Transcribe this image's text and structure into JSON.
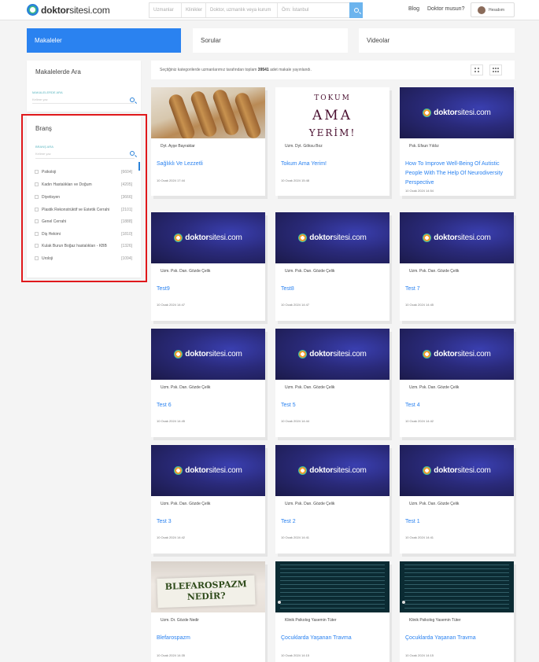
{
  "header": {
    "logo_bold": "doktor",
    "logo_rest": "sitesi.com",
    "search_segments": [
      "Uzmanlar",
      "Klinikler",
      "Doktor, uzmanlık veya kurum",
      "Örn: İstanbul"
    ],
    "blog": "Blog",
    "doctor_q": "Doktor musun?",
    "account": "Hesabım"
  },
  "tabs": [
    "Makaleler",
    "Sorular",
    "Videolar"
  ],
  "sidebar": {
    "search_title": "Makalelerde Ara",
    "search_label": "MAKALELERDE ARA",
    "search_placeholder": "Kelime yaz",
    "branch_title": "Branş",
    "branch_label": "BRANŞ ARA",
    "branch_placeholder": "Kelime yaz",
    "branches": [
      {
        "name": "Psikoloji",
        "count": "[6604]"
      },
      {
        "name": "Kadın Hastalıkları ve Doğum",
        "count": "[4205]"
      },
      {
        "name": "Diyetisyen",
        "count": "[3666]"
      },
      {
        "name": "Plastik Rekonstrüktif ve Estetik Cerrahi",
        "count": "[2101]"
      },
      {
        "name": "Genel Cerrahi",
        "count": "[1888]"
      },
      {
        "name": "Diş Hekimi",
        "count": "[1810]"
      },
      {
        "name": "Kulak Burun Boğaz hastalıkları - KBB",
        "count": "[1326]"
      },
      {
        "name": "Üroloji",
        "count": "[1094]"
      }
    ]
  },
  "info": {
    "prefix": "Seçtiğiniz kategorilerde uzmanlarımız tarafından toplam ",
    "count": "39541",
    "suffix": " adet makale yayınlandı."
  },
  "brand_thumb": {
    "bold": "doktor",
    "rest": "sitesi.com"
  },
  "cards": [
    {
      "thumb": "food",
      "author": "Dyt. Ayşe Bayraktar",
      "title": "Sağlıklı Ve Lezzetli",
      "date": "10 Ocak 2024 17:44"
    },
    {
      "thumb": "tokum",
      "thumb_text": [
        "TOKUM",
        "AMA",
        "YERİM!"
      ],
      "author": "Uzm. Dyt. Göksu Boz",
      "title": "Tokum Ama Yerim!",
      "date": "10 Ocak 2024 15:48"
    },
    {
      "thumb": "brand",
      "author": "Psk. Efsun Yıldız",
      "title": "How To Improve Well-Being Of Autistic People With The Help Of Neurodiversity Perspective",
      "date": "10 Ocak 2024 14:54"
    },
    {
      "thumb": "brand",
      "author": "Uzm. Psk. Dan. Gözde Çelik",
      "title": "Test9",
      "date": "10 Ocak 2024 14:47"
    },
    {
      "thumb": "brand",
      "author": "Uzm. Psk. Dan. Gözde Çelik",
      "title": "Test8",
      "date": "10 Ocak 2024 14:47"
    },
    {
      "thumb": "brand",
      "author": "Uzm. Psk. Dan. Gözde Çelik",
      "title": "Test 7",
      "date": "10 Ocak 2024 14:45"
    },
    {
      "thumb": "brand",
      "author": "Uzm. Psk. Dan. Gözde Çelik",
      "title": "Test 6",
      "date": "10 Ocak 2024 14:45"
    },
    {
      "thumb": "brand",
      "author": "Uzm. Psk. Dan. Gözde Çelik",
      "title": "Test 5",
      "date": "10 Ocak 2024 14:44"
    },
    {
      "thumb": "brand",
      "author": "Uzm. Psk. Dan. Gözde Çelik",
      "title": "Test 4",
      "date": "10 Ocak 2024 14:42"
    },
    {
      "thumb": "brand",
      "author": "Uzm. Psk. Dan. Gözde Çelik",
      "title": "Test 3",
      "date": "10 Ocak 2024 14:42"
    },
    {
      "thumb": "brand",
      "author": "Uzm. Psk. Dan. Gözde Çelik",
      "title": "Test 2",
      "date": "10 Ocak 2024 14:41"
    },
    {
      "thumb": "brand",
      "author": "Uzm. Psk. Dan. Gözde Çelik",
      "title": "Test 1",
      "date": "10 Ocak 2024 14:41"
    },
    {
      "thumb": "bleph",
      "thumb_text": [
        "BLEFAROSPAZM",
        "NEDİR?"
      ],
      "author": "Uzm. Dr. Gözde Nedir",
      "title": "Blefarospazm",
      "date": "10 Ocak 2024 14:35"
    },
    {
      "thumb": "dark",
      "author": "Klinik Psikolog Yasemin Tüter",
      "title": "Çocuklarda Yaşanan Travma",
      "date": "10 Ocak 2024 14:15"
    },
    {
      "thumb": "dark",
      "author": "Klinik Psikolog Yasemin Tüter",
      "title": "Çocuklarda Yaşanan Travma",
      "date": "10 Ocak 2024 14:15"
    }
  ],
  "colors": {
    "accent": "#2a82f0",
    "highlight": "#e0181b",
    "brand_bg": "#2a2a7a"
  }
}
